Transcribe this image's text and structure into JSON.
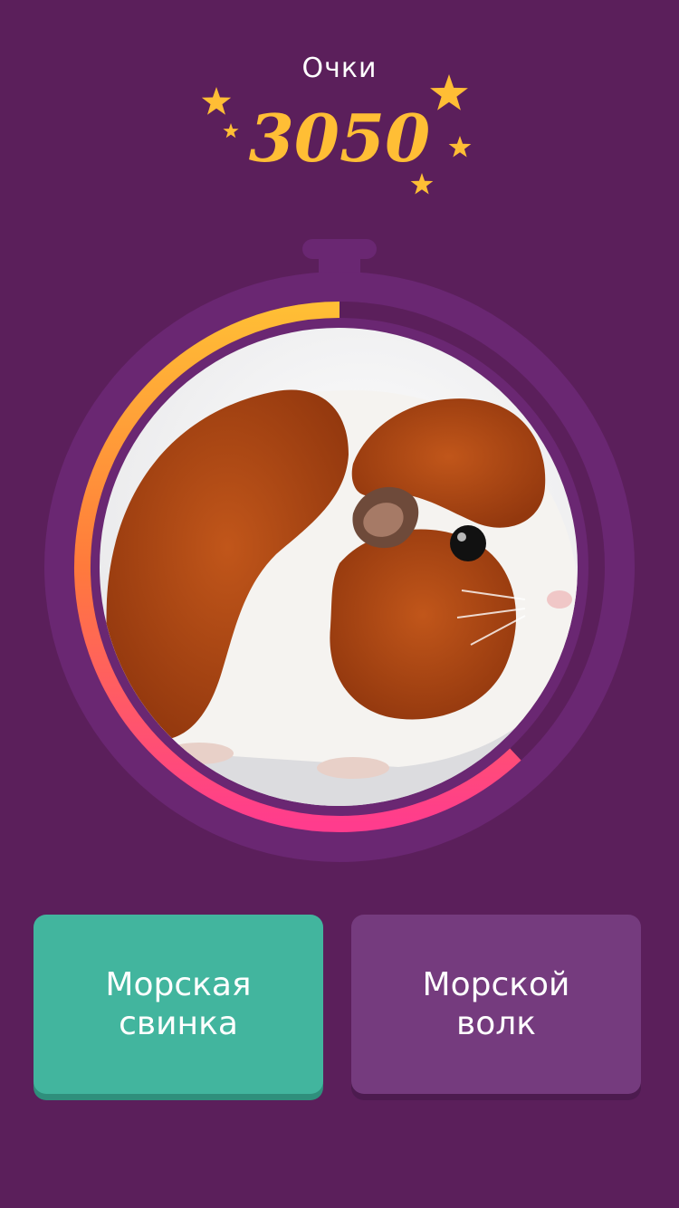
{
  "score": {
    "label": "Очки",
    "value": "3050"
  },
  "timer": {
    "progress_remaining": 0.62
  },
  "question": {
    "image_icon": "guinea-pig-photo"
  },
  "answers": [
    {
      "label": "Морская свинка",
      "state": "correct"
    },
    {
      "label": "Морской волк",
      "state": "default"
    }
  ],
  "colors": {
    "background": "#5b1f5b",
    "star": "#ffbe35",
    "correct": "#42b59e",
    "answer": "#753b7e",
    "timer_start": "#ffbe35",
    "timer_end": "#ff3c8d"
  }
}
